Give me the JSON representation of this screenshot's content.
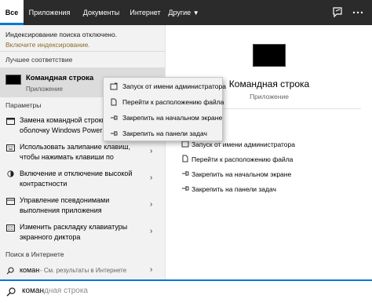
{
  "tabs": [
    {
      "label": "Все"
    },
    {
      "label": "Приложения"
    },
    {
      "label": "Документы"
    },
    {
      "label": "Интернет"
    },
    {
      "label": "Другие"
    }
  ],
  "notice": {
    "line": "Индексирование поиска отключено.",
    "link": "Включите индексирование."
  },
  "best_match": {
    "heading": "Лучшее соответствие",
    "title": "Командная строка",
    "subtitle": "Приложение"
  },
  "settings": {
    "heading": "Параметры",
    "items": [
      {
        "line1": "Замена командной строки",
        "line2": "оболочку Windows PowerShell"
      },
      {
        "line1": "Использовать залипание клавиш,",
        "line2": "чтобы нажимать клавиши по"
      },
      {
        "line1": "Включение и отключение высокой",
        "line2": "контрастности"
      },
      {
        "line1": "Управление псевдонимами",
        "line2": "выполнения приложения"
      },
      {
        "line1": "Изменить раскладку клавиатуры",
        "line2": "экранного диктора"
      }
    ]
  },
  "web": {
    "heading": "Поиск в Интернете",
    "query": "коман",
    "hint": " - См. результаты в Интернете"
  },
  "search": {
    "typed": "коман",
    "completion": "дная строка"
  },
  "preview": {
    "title": "Командная строка",
    "subtitle": "Приложение",
    "actions": [
      {
        "label": "Запуск от имени администратора"
      },
      {
        "label": "Перейти к расположению файла"
      },
      {
        "label": "Закрепить на начальном экране"
      },
      {
        "label": "Закрепить на панели задач"
      }
    ]
  },
  "context_menu": {
    "items": [
      {
        "label": "Запуск от имени администратора"
      },
      {
        "label": "Перейти к расположению файла"
      },
      {
        "label": "Закрепить на начальном экране"
      },
      {
        "label": "Закрепить на панели задач"
      }
    ]
  },
  "colors": {
    "accent": "#0078d7",
    "topbar": "#2b2b2b",
    "link": "#8a6d2d"
  }
}
